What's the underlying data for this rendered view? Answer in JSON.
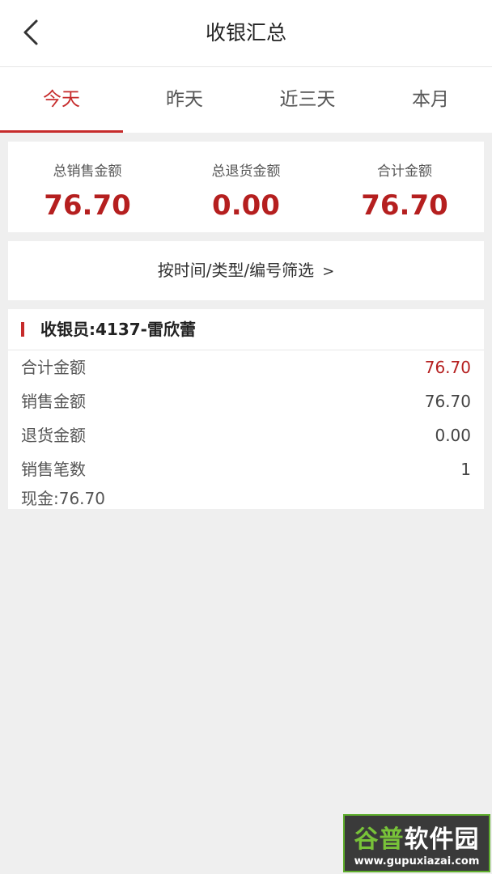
{
  "header": {
    "title": "收银汇总"
  },
  "tabs": [
    {
      "label": "今天",
      "active": true
    },
    {
      "label": "昨天",
      "active": false
    },
    {
      "label": "近三天",
      "active": false
    },
    {
      "label": "本月",
      "active": false
    }
  ],
  "summary": {
    "sales_label": "总销售金额",
    "sales_value": "76.70",
    "returns_label": "总退货金额",
    "returns_value": "0.00",
    "total_label": "合计金额",
    "total_value": "76.70"
  },
  "filter": {
    "label": "按时间/类型/编号筛选",
    "chevron": ">"
  },
  "cashier_card": {
    "title": "收银员:4137-雷欣蕾",
    "rows": [
      {
        "label": "合计金额",
        "value": "76.70"
      },
      {
        "label": "销售金额",
        "value": "76.70"
      },
      {
        "label": "退货金额",
        "value": "0.00"
      },
      {
        "label": "销售笔数",
        "value": "1"
      }
    ],
    "payment": "现金:76.70"
  },
  "watermark": {
    "brand_a": "谷普",
    "brand_b": "软件园",
    "url": "www.gupuxiazai.com"
  },
  "colors": {
    "accent": "#c62b2b",
    "value_red": "#b51f1f",
    "background": "#efefef"
  },
  "icons": {
    "back": "chevron-left-icon"
  }
}
